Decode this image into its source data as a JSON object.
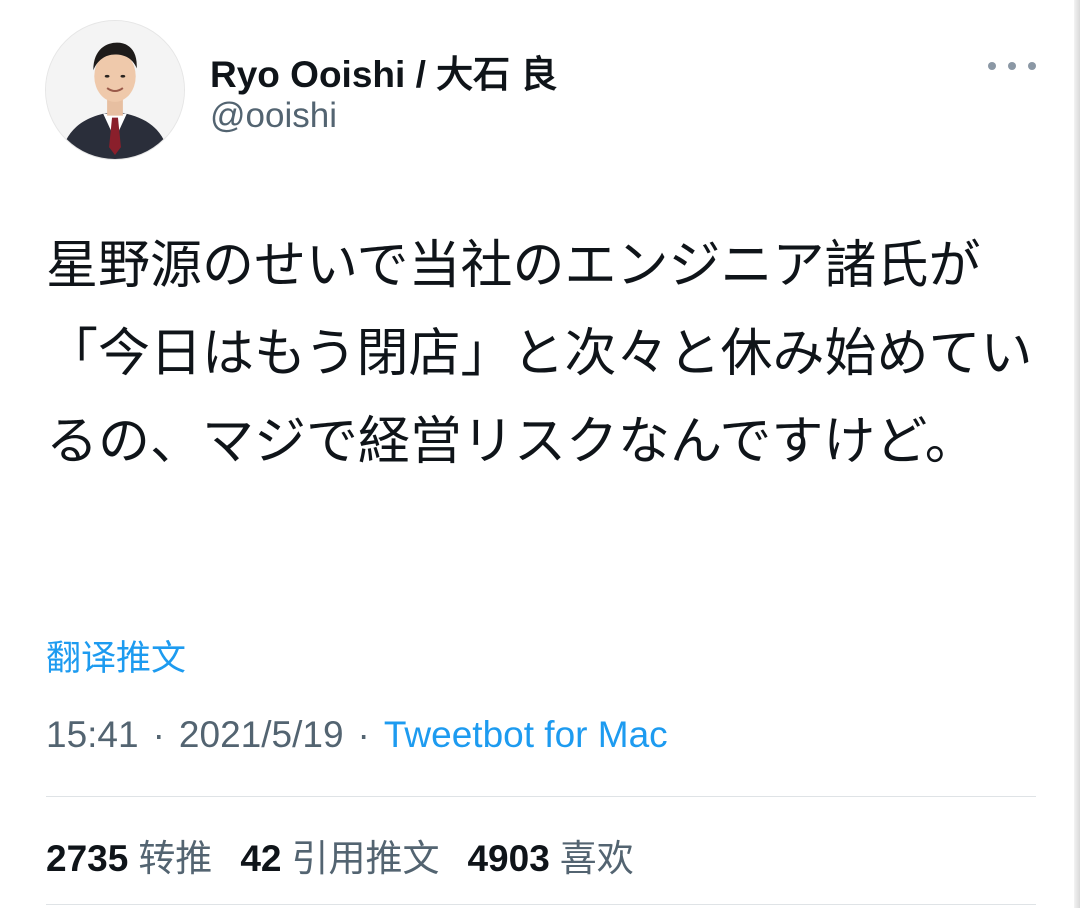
{
  "colors": {
    "text_primary": "#0f1419",
    "text_secondary": "#536471",
    "link": "#1d9bf0",
    "divider": "#dfe3e6"
  },
  "author": {
    "display_name": "Ryo Ooishi / 大石 良",
    "handle": "@ooishi",
    "avatar_icon": "profile-photo-avatar"
  },
  "menu": {
    "icon": "more-horizontal-icon"
  },
  "tweet": {
    "text": "星野源のせいで当社のエンジニア諸氏が「今日はもう閉店」と次々と休み始めているの、マジで経営リスクなんですけど。"
  },
  "translate": {
    "label": "翻译推文"
  },
  "meta": {
    "time": "15:41",
    "separator": "·",
    "date": "2021/5/19",
    "source": "Tweetbot for Mac"
  },
  "stats": [
    {
      "count": "2735",
      "label": "转推"
    },
    {
      "count": "42",
      "label": "引用推文"
    },
    {
      "count": "4903",
      "label": "喜欢"
    }
  ]
}
